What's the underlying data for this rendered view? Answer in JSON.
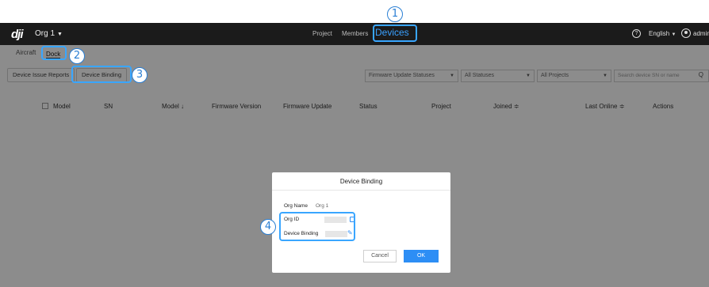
{
  "callouts": [
    "1",
    "2",
    "3",
    "4"
  ],
  "topbar": {
    "logo": "dji",
    "org_name": "Org 1",
    "nav": [
      "Project",
      "Members",
      "Devices"
    ],
    "help_icon": "?",
    "language": "English",
    "user": "admin"
  },
  "tabs": [
    "Aircraft",
    "Dock"
  ],
  "toolbar": {
    "issue_reports": "Device Issue Reports",
    "device_binding": "Device Binding",
    "firmware_filter": "Firmware Update Statuses",
    "status_filter": "All Statuses",
    "project_filter": "All Projects",
    "search_placeholder": "Search device SN or name",
    "search_icon": "Q"
  },
  "table": {
    "columns": [
      "Model",
      "SN",
      "Model ↓",
      "Firmware Version",
      "Firmware Update",
      "Status",
      "Project",
      "Joined ≑",
      "Last Online ≑",
      "Actions"
    ]
  },
  "modal": {
    "title": "Device Binding",
    "org_name_label": "Org Name",
    "org_name_value": "Org 1",
    "org_id_label": "Org ID",
    "device_binding_label": "Device Binding",
    "edit_icon": "✎",
    "cancel_label": "Cancel",
    "ok_label": "OK"
  },
  "colors": {
    "accent": "#2d8ef5",
    "highlight": "#39a6ff",
    "topbar_bg": "#1b1b1b"
  }
}
